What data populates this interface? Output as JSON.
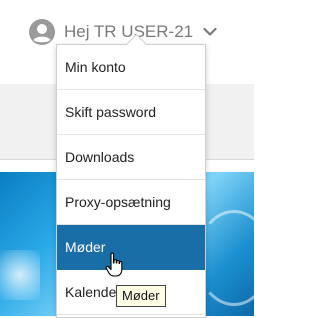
{
  "header": {
    "user_label": "Hej TR USER-21",
    "avatar_icon": "user-circle-icon",
    "chevron_icon": "chevron-down-icon"
  },
  "dropdown": {
    "items": [
      {
        "label": "Min konto"
      },
      {
        "label": "Skift password"
      },
      {
        "label": "Downloads"
      },
      {
        "label": "Proxy-opsætning"
      },
      {
        "label": "Møder",
        "active": true
      },
      {
        "label": "Kalender"
      }
    ]
  },
  "tooltip": {
    "text": "Møder"
  },
  "colors": {
    "active_item_bg": "#1a6ea8",
    "header_text": "#7a7a7a",
    "image_blue": "#2aa9e8"
  }
}
